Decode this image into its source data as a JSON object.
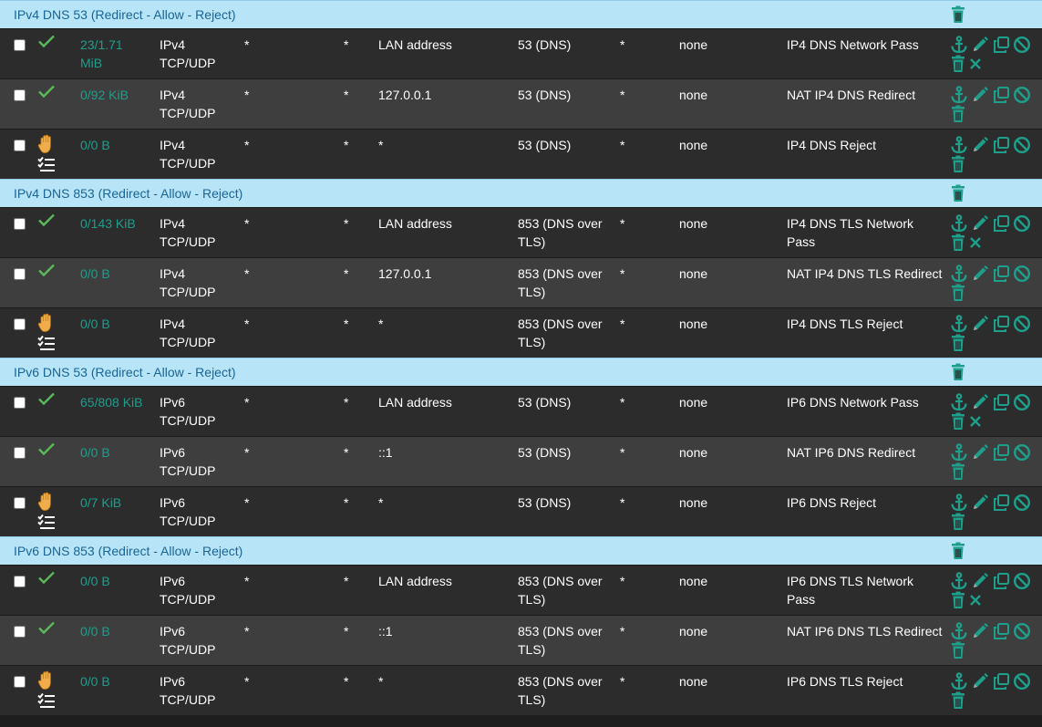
{
  "colors": {
    "accent": "#1d9f8c",
    "pass": "#5cb85c",
    "reject": "#f0ad4e",
    "separator_bg": "#b7e4f7",
    "separator_text": "#1a6496"
  },
  "sections": [
    {
      "title": "IPv4 DNS 53 (Redirect - Allow - Reject)",
      "rules": [
        {
          "status": "pass",
          "states": "23/1.71 MiB",
          "protocol": "IPv4 TCP/UDP",
          "source": "*",
          "source_port": "*",
          "destination": "LAN address",
          "destination_port": "53 (DNS)",
          "gateway": "*",
          "queue": "none",
          "description": "IP4 DNS Network Pass",
          "has_cancel": true
        },
        {
          "status": "pass",
          "states": "0/92 KiB",
          "protocol": "IPv4 TCP/UDP",
          "source": "*",
          "source_port": "*",
          "destination": "127.0.0.1",
          "destination_port": "53 (DNS)",
          "gateway": "*",
          "queue": "none",
          "description": "NAT IP4 DNS Redirect",
          "has_cancel": false
        },
        {
          "status": "reject",
          "states": "0/0 B",
          "protocol": "IPv4 TCP/UDP",
          "source": "*",
          "source_port": "*",
          "destination": "*",
          "destination_port": "53 (DNS)",
          "gateway": "*",
          "queue": "none",
          "description": "IP4 DNS Reject",
          "has_cancel": false
        }
      ]
    },
    {
      "title": "IPv4 DNS 853 (Redirect - Allow - Reject)",
      "rules": [
        {
          "status": "pass",
          "states": "0/143 KiB",
          "protocol": "IPv4 TCP/UDP",
          "source": "*",
          "source_port": "*",
          "destination": "LAN address",
          "destination_port": "853 (DNS over TLS)",
          "gateway": "*",
          "queue": "none",
          "description": "IP4 DNS TLS Network Pass",
          "has_cancel": true
        },
        {
          "status": "pass",
          "states": "0/0 B",
          "protocol": "IPv4 TCP/UDP",
          "source": "*",
          "source_port": "*",
          "destination": "127.0.0.1",
          "destination_port": "853 (DNS over TLS)",
          "gateway": "*",
          "queue": "none",
          "description": "NAT IP4 DNS TLS Redirect",
          "has_cancel": false
        },
        {
          "status": "reject",
          "states": "0/0 B",
          "protocol": "IPv4 TCP/UDP",
          "source": "*",
          "source_port": "*",
          "destination": "*",
          "destination_port": "853 (DNS over TLS)",
          "gateway": "*",
          "queue": "none",
          "description": "IP4 DNS TLS Reject",
          "has_cancel": false
        }
      ]
    },
    {
      "title": "IPv6 DNS 53 (Redirect - Allow - Reject)",
      "rules": [
        {
          "status": "pass",
          "states": "65/808 KiB",
          "protocol": "IPv6 TCP/UDP",
          "source": "*",
          "source_port": "*",
          "destination": "LAN address",
          "destination_port": "53 (DNS)",
          "gateway": "*",
          "queue": "none",
          "description": "IP6 DNS Network Pass",
          "has_cancel": true
        },
        {
          "status": "pass",
          "states": "0/0 B",
          "protocol": "IPv6 TCP/UDP",
          "source": "*",
          "source_port": "*",
          "destination": "::1",
          "destination_port": "53 (DNS)",
          "gateway": "*",
          "queue": "none",
          "description": "NAT IP6 DNS Redirect",
          "has_cancel": false
        },
        {
          "status": "reject",
          "states": "0/7 KiB",
          "protocol": "IPv6 TCP/UDP",
          "source": "*",
          "source_port": "*",
          "destination": "*",
          "destination_port": "53 (DNS)",
          "gateway": "*",
          "queue": "none",
          "description": "IP6 DNS Reject",
          "has_cancel": false
        }
      ]
    },
    {
      "title": "IPv6 DNS 853 (Redirect - Allow - Reject)",
      "rules": [
        {
          "status": "pass",
          "states": "0/0 B",
          "protocol": "IPv6 TCP/UDP",
          "source": "*",
          "source_port": "*",
          "destination": "LAN address",
          "destination_port": "853 (DNS over TLS)",
          "gateway": "*",
          "queue": "none",
          "description": "IP6 DNS TLS Network Pass",
          "has_cancel": true
        },
        {
          "status": "pass",
          "states": "0/0 B",
          "protocol": "IPv6 TCP/UDP",
          "source": "*",
          "source_port": "*",
          "destination": "::1",
          "destination_port": "853 (DNS over TLS)",
          "gateway": "*",
          "queue": "none",
          "description": "NAT IP6 DNS TLS Redirect",
          "has_cancel": false
        },
        {
          "status": "reject",
          "states": "0/0 B",
          "protocol": "IPv6 TCP/UDP",
          "source": "*",
          "source_port": "*",
          "destination": "*",
          "destination_port": "853 (DNS over TLS)",
          "gateway": "*",
          "queue": "none",
          "description": "IP6 DNS TLS Reject",
          "has_cancel": false
        }
      ]
    }
  ]
}
